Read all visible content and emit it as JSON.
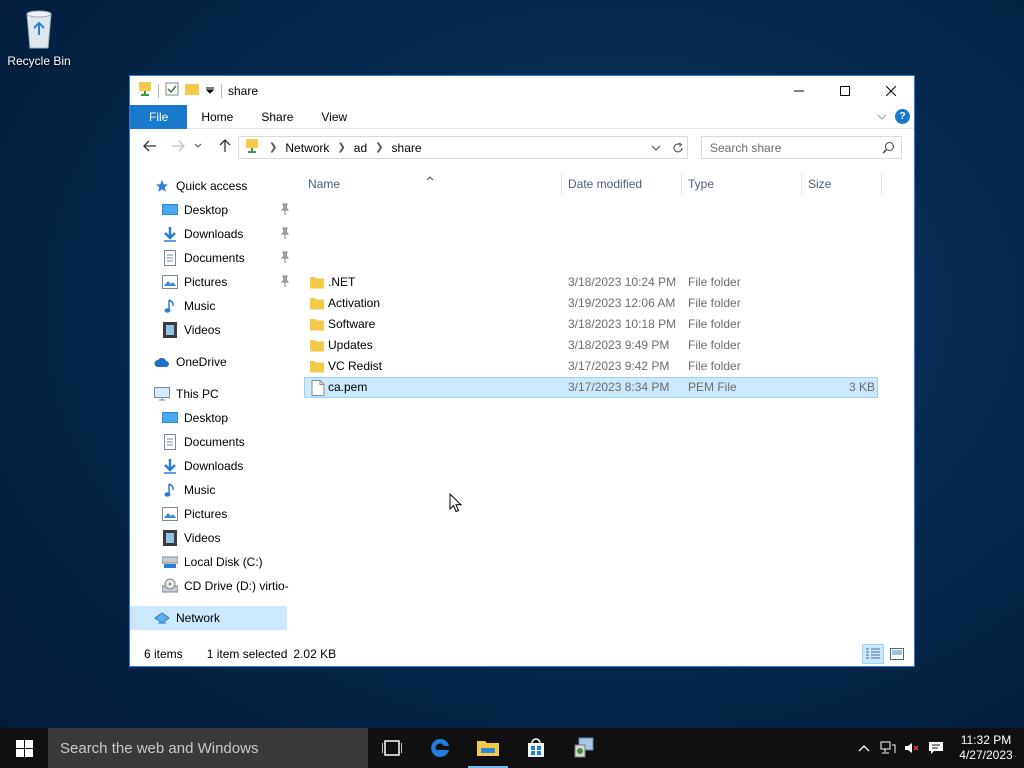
{
  "desktop": {
    "recycle_bin_label": "Recycle Bin"
  },
  "window": {
    "title": "share",
    "ribbon_tabs": [
      "File",
      "Home",
      "Share",
      "View"
    ],
    "address": {
      "crumbs": [
        "Network",
        "ad",
        "share"
      ]
    },
    "search_placeholder": "Search share",
    "help_glyph": "?"
  },
  "navpane": {
    "items": [
      {
        "label": "Quick access",
        "icon": "star-icon",
        "pinned": false
      },
      {
        "label": "Desktop",
        "icon": "desktop-icon",
        "pinned": true
      },
      {
        "label": "Downloads",
        "icon": "download-icon",
        "pinned": true
      },
      {
        "label": "Documents",
        "icon": "document-icon",
        "pinned": true
      },
      {
        "label": "Pictures",
        "icon": "picture-icon",
        "pinned": true
      },
      {
        "label": "Music",
        "icon": "music-icon",
        "pinned": false
      },
      {
        "label": "Videos",
        "icon": "video-icon",
        "pinned": false
      },
      {
        "label": "OneDrive",
        "icon": "cloud-icon",
        "pinned": false
      },
      {
        "label": "This PC",
        "icon": "computer-icon",
        "pinned": false
      },
      {
        "label": "Desktop",
        "icon": "desktop-icon",
        "pinned": false
      },
      {
        "label": "Documents",
        "icon": "document-icon",
        "pinned": false
      },
      {
        "label": "Downloads",
        "icon": "download-icon",
        "pinned": false
      },
      {
        "label": "Music",
        "icon": "music-icon",
        "pinned": false
      },
      {
        "label": "Pictures",
        "icon": "picture-icon",
        "pinned": false
      },
      {
        "label": "Videos",
        "icon": "video-icon",
        "pinned": false
      },
      {
        "label": "Local Disk (C:)",
        "icon": "disk-icon",
        "pinned": false
      },
      {
        "label": "CD Drive (D:) virtio-",
        "icon": "cd-drive-icon",
        "pinned": false
      },
      {
        "label": "Network",
        "icon": "network-icon",
        "pinned": false,
        "selected": true
      }
    ]
  },
  "filelist": {
    "columns": [
      "Name",
      "Date modified",
      "Type",
      "Size"
    ],
    "rows": [
      {
        "name": ".NET",
        "date": "3/18/2023 10:24 PM",
        "type": "File folder",
        "size": ""
      },
      {
        "name": "Activation",
        "date": "3/19/2023 12:06 AM",
        "type": "File folder",
        "size": ""
      },
      {
        "name": "Software",
        "date": "3/18/2023 10:18 PM",
        "type": "File folder",
        "size": ""
      },
      {
        "name": "Updates",
        "date": "3/18/2023 9:49 PM",
        "type": "File folder",
        "size": ""
      },
      {
        "name": "VC Redist",
        "date": "3/17/2023 9:42 PM",
        "type": "File folder",
        "size": ""
      },
      {
        "name": "ca.pem",
        "date": "3/17/2023 8:34 PM",
        "type": "PEM File",
        "size": "3 KB",
        "selected": true
      }
    ]
  },
  "statusbar": {
    "item_count": "6 items",
    "selection": "1 item selected",
    "selection_size": "2.02 KB"
  },
  "taskbar": {
    "search_placeholder": "Search the web and Windows",
    "clock_time": "11:32 PM",
    "clock_date": "4/27/2023"
  },
  "colors": {
    "accent": "#1979ca",
    "selection": "#cce8ff",
    "selection_border": "#99d1ff",
    "folder": "#f5c94a"
  }
}
